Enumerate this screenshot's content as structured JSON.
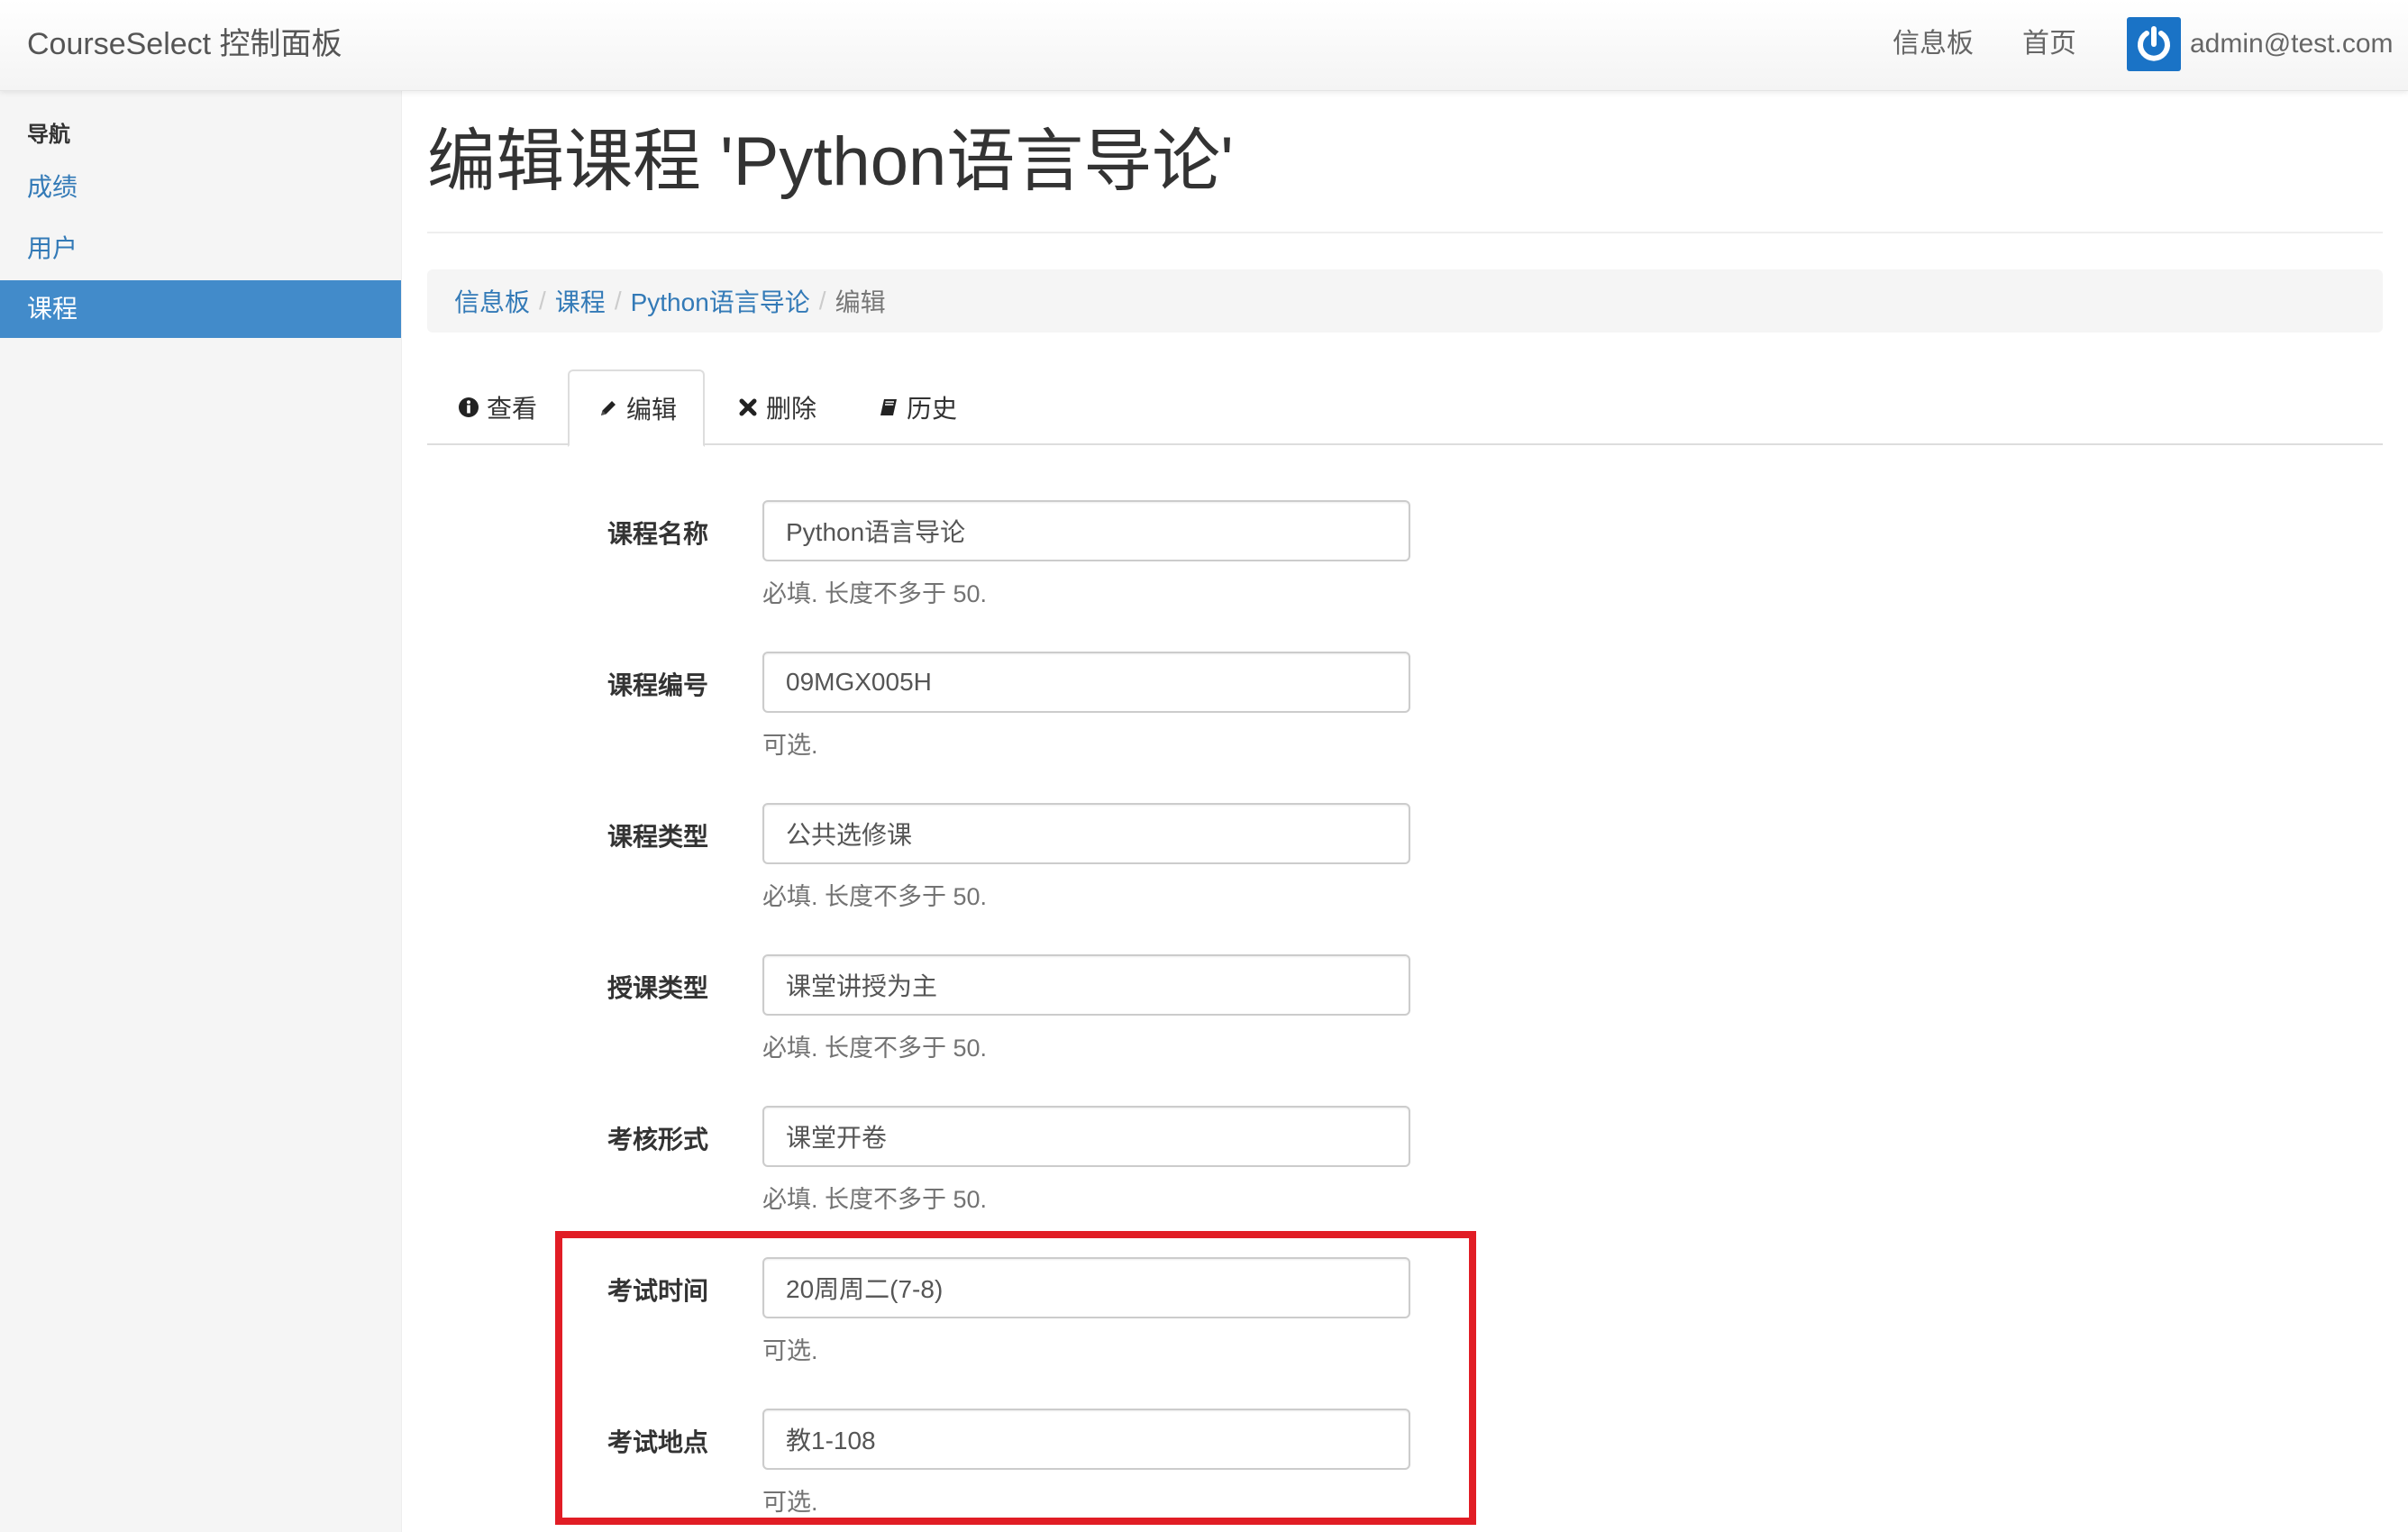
{
  "navbar": {
    "brand": "CourseSelect 控制面板",
    "dashboard": "信息板",
    "home": "首页",
    "user_email": "admin@test.com",
    "avatar_icon": "power-icon",
    "avatar_color": "#1a73c6"
  },
  "sidebar": {
    "heading": "导航",
    "items": [
      {
        "label": "成绩",
        "active": false
      },
      {
        "label": "用户",
        "active": false
      },
      {
        "label": "课程",
        "active": true
      }
    ],
    "active_color": "#428bca"
  },
  "page": {
    "title": "编辑课程 'Python语言导论'"
  },
  "breadcrumb": {
    "items": [
      "信息板",
      "课程",
      "Python语言导论"
    ],
    "active": "编辑",
    "separator": "/"
  },
  "tabs": [
    {
      "label": "查看",
      "icon": "info-circle-icon"
    },
    {
      "label": "编辑",
      "icon": "pencil-icon",
      "active": true
    },
    {
      "label": "删除",
      "icon": "x-icon"
    },
    {
      "label": "历史",
      "icon": "book-icon"
    }
  ],
  "form": {
    "fields": [
      {
        "label": "课程名称",
        "value": "Python语言导论",
        "help": "必填. 长度不多于 50."
      },
      {
        "label": "课程编号",
        "value": "09MGX005H",
        "help": "可选."
      },
      {
        "label": "课程类型",
        "value": "公共选修课",
        "help": "必填. 长度不多于 50."
      },
      {
        "label": "授课类型",
        "value": "课堂讲授为主",
        "help": "必填. 长度不多于 50."
      },
      {
        "label": "考核形式",
        "value": "课堂开卷",
        "help": "必填. 长度不多于 50."
      },
      {
        "label": "考试时间",
        "value": "20周周二(7-8)",
        "help": "可选."
      },
      {
        "label": "考试地点",
        "value": "教1-108",
        "help": "可选."
      }
    ]
  },
  "highlight_color": "#e11d25"
}
